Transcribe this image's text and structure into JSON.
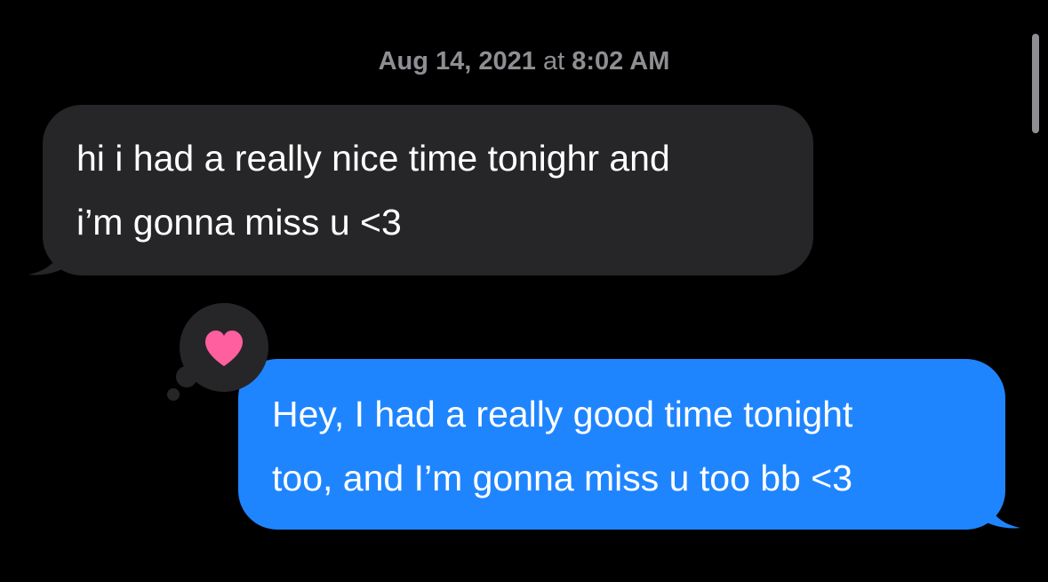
{
  "timestamp": {
    "date": "Aug 14, 2021",
    "at": "at",
    "time": "8:02 AM"
  },
  "messages": [
    {
      "direction": "received",
      "lines": [
        "hi i had a really nice time tonighr and",
        "i’m gonna miss u <3"
      ]
    },
    {
      "direction": "sent",
      "lines": [
        "Hey, I had a really good time tonight",
        "too, and I’m gonna miss u too bb <3"
      ],
      "tapback": "heart-icon"
    }
  ],
  "colors": {
    "background": "#000000",
    "received_bubble": "#262629",
    "sent_bubble": "#1f85ff",
    "tapback_heart": "#ff5f9e",
    "timestamp_text": "#8e8e93"
  }
}
